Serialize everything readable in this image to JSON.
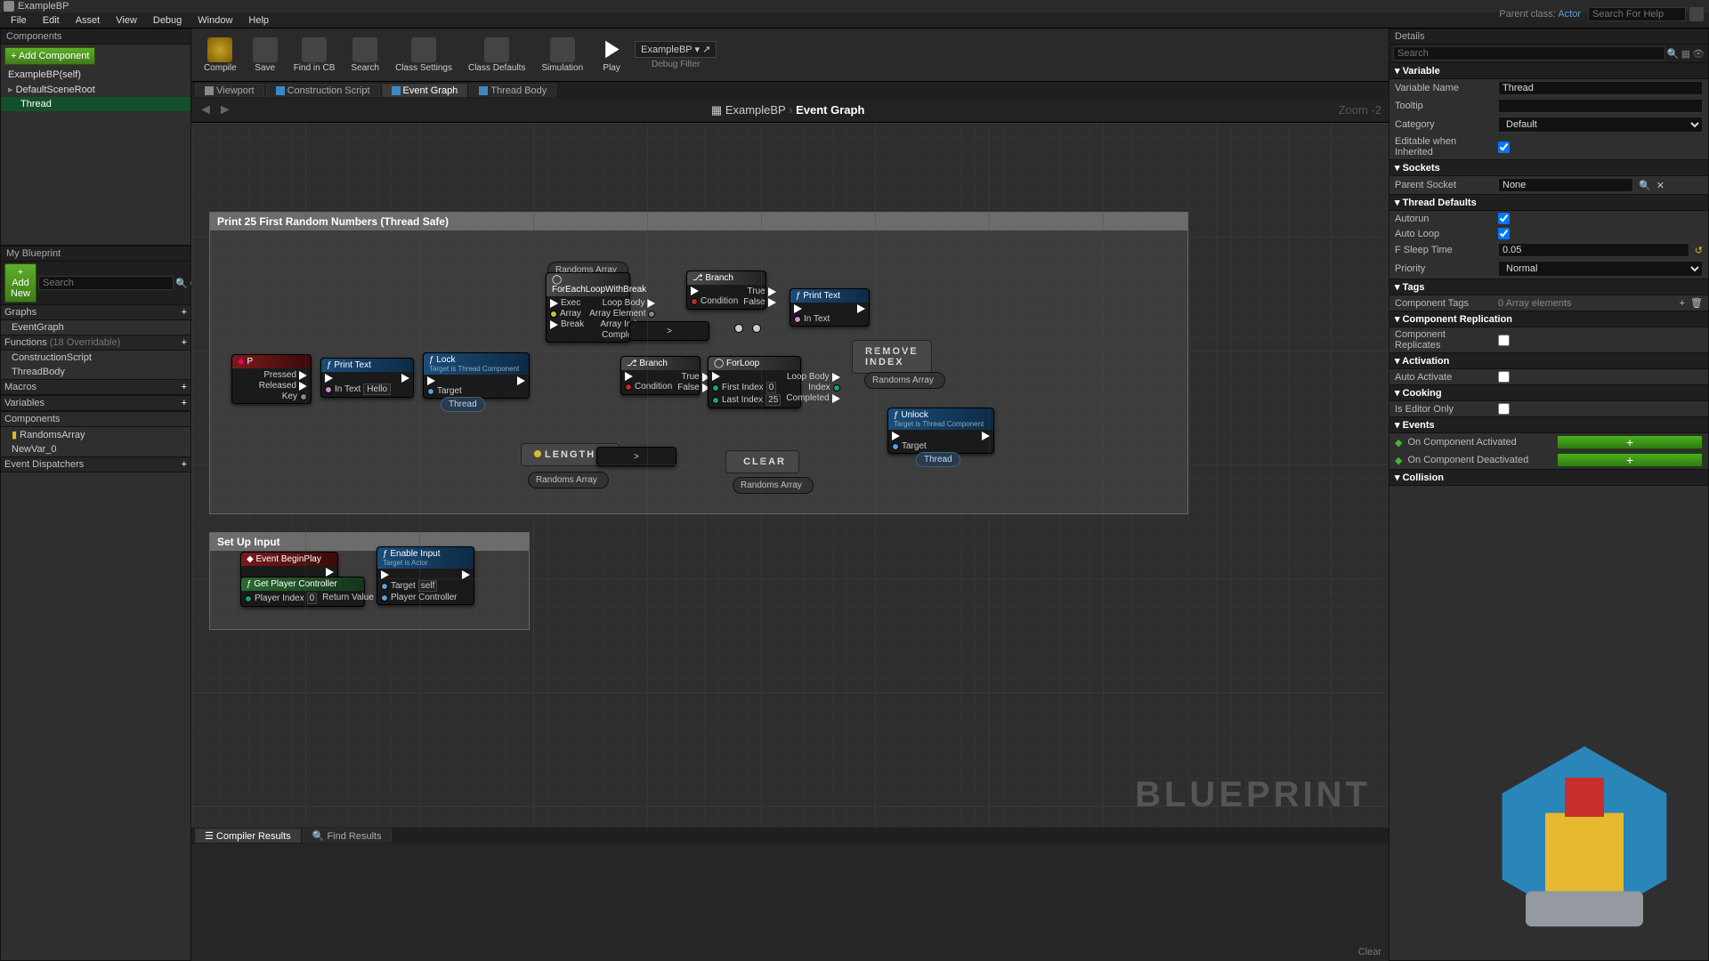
{
  "title": "ExampleBP",
  "menu": [
    "File",
    "Edit",
    "Asset",
    "View",
    "Debug",
    "Window",
    "Help"
  ],
  "parent_class_label": "Parent class:",
  "parent_class": "Actor",
  "search_help_placeholder": "Search For Help",
  "toolbar": {
    "compile": "Compile",
    "save": "Save",
    "find": "Find in CB",
    "search": "Search",
    "class_settings": "Class Settings",
    "class_defaults": "Class Defaults",
    "simulation": "Simulation",
    "play": "Play",
    "debug_filter": "Debug Filter",
    "debug_target": "ExampleBP"
  },
  "components": {
    "tab": "Components",
    "add": "+ Add Component",
    "root": "ExampleBP(self)",
    "scene": "DefaultSceneRoot",
    "thread": "Thread"
  },
  "myblueprint": {
    "tab": "My Blueprint",
    "addnew": "+ Add New",
    "search_placeholder": "Search",
    "graphs": {
      "header": "Graphs",
      "items": [
        "EventGraph"
      ]
    },
    "functions": {
      "header": "Functions",
      "note": "(18 Overridable)",
      "items": [
        "ConstructionScript",
        "ThreadBody"
      ]
    },
    "macros": {
      "header": "Macros"
    },
    "variables": {
      "header": "Variables"
    },
    "compcat": {
      "header": "Components",
      "items": [
        "RandomsArray",
        "NewVar_0"
      ]
    },
    "dispatchers": {
      "header": "Event Dispatchers"
    }
  },
  "subtabs": [
    "Viewport",
    "Construction Script",
    "Event Graph",
    "Thread Body"
  ],
  "breadcrumb": {
    "a": "ExampleBP",
    "b": "Event Graph"
  },
  "zoom": "Zoom -2",
  "watermark": "BLUEPRINT",
  "comments": {
    "c1": "Print 25 First Random Numbers (Thread Safe)",
    "c2": "Set Up Input"
  },
  "nodes": {
    "inputP": {
      "title": "P",
      "p1": "Pressed",
      "p2": "Released",
      "p3": "Key"
    },
    "printText1": {
      "title": "Print Text",
      "in": "In Text",
      "hello": "Hello"
    },
    "lock": {
      "title": "Lock",
      "sub": "Target is Thread Component",
      "target": "Target",
      "thread": "Thread"
    },
    "randoms": "Randoms Array",
    "foreach": {
      "title": "ForEachLoopWithBreak",
      "exec": "Exec",
      "array": "Array",
      "break": "Break",
      "loop": "Loop Body",
      "elem": "Array Element",
      "idx": "Array Index",
      "done": "Completed"
    },
    "branch": {
      "title": "Branch",
      "cond": "Condition",
      "t": "True",
      "f": "False"
    },
    "printText2": {
      "title": "Print Text",
      "in": "In Text"
    },
    "forloop": {
      "title": "ForLoop",
      "first": "First Index",
      "last": "Last Index",
      "loop": "Loop Body",
      "idx": "Index",
      "done": "Completed"
    },
    "length": "LENGTH",
    "clear": "CLEAR",
    "remove": "REMOVE INDEX",
    "unlock": {
      "title": "Unlock",
      "sub": "Target is Thread Component",
      "target": "Target",
      "thread": "Thread"
    },
    "beginplay": "Event BeginPlay",
    "getpc": {
      "title": "Get Player Controller",
      "pi": "Player Index",
      "rv": "Return Value"
    },
    "enable": {
      "title": "Enable Input",
      "sub": "Target is Actor",
      "target": "Target",
      "self": "self",
      "pc": "Player Controller"
    }
  },
  "bottom": {
    "tabs": [
      "Compiler Results",
      "Find Results"
    ],
    "clear": "Clear"
  },
  "details": {
    "tab": "Details",
    "search_placeholder": "Search",
    "variable": {
      "header": "Variable",
      "name_l": "Variable Name",
      "name_v": "Thread",
      "tooltip_l": "Tooltip",
      "tooltip_v": "",
      "cat_l": "Category",
      "cat_v": "Default",
      "edit_l": "Editable when Inherited"
    },
    "sockets": {
      "header": "Sockets",
      "parent_l": "Parent Socket",
      "parent_v": "None"
    },
    "thread": {
      "header": "Thread Defaults",
      "autorun_l": "Autorun",
      "autoloop_l": "Auto Loop",
      "sleep_l": "F Sleep Time",
      "sleep_v": "0.05",
      "prio_l": "Priority",
      "prio_v": "Normal"
    },
    "tags": {
      "header": "Tags",
      "ct_l": "Component Tags",
      "ct_v": "0 Array elements"
    },
    "rep": {
      "header": "Component Replication",
      "l": "Component Replicates"
    },
    "act": {
      "header": "Activation",
      "l": "Auto Activate"
    },
    "cook": {
      "header": "Cooking",
      "l": "Is Editor Only"
    },
    "events": {
      "header": "Events",
      "a": "On Component Activated",
      "b": "On Component Deactivated"
    },
    "collision": {
      "header": "Collision"
    }
  }
}
